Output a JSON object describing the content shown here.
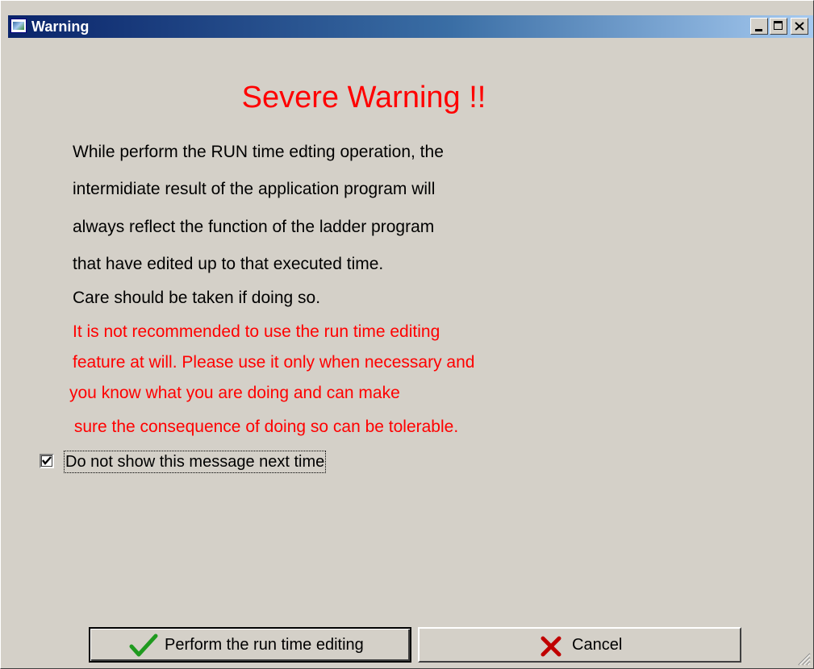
{
  "window": {
    "title": "Warning",
    "controls": {
      "minimize": "minimize",
      "maximize": "maximize",
      "close": "close"
    }
  },
  "heading": "Severe Warning !!",
  "message": {
    "lines": [
      "While perform the RUN time edting operation, the",
      "intermidiate result of the application program will",
      "always reflect the function of the ladder program",
      "that have edited up to that executed time.",
      "Care should be taken if doing so."
    ],
    "warning_lines": [
      "It is not recommended to use the run time editing",
      "feature at will. Please use it only when necessary and",
      "you know what you are doing and can make",
      " sure the consequence of doing so can be tolerable."
    ]
  },
  "checkbox": {
    "label": "Do not show this message next time",
    "checked": true
  },
  "buttons": {
    "ok_label": "Perform the run time editing",
    "cancel_label": "Cancel"
  },
  "colors": {
    "warning_red": "#ff0000",
    "window_face": "#d4d0c8",
    "titlebar_start": "#0a246a",
    "titlebar_end": "#a6caf0",
    "check_green": "#1f9a1f",
    "cancel_x": "#c00000"
  },
  "icons": {
    "app": "app-window-icon",
    "ok": "green-checkmark-icon",
    "cancel": "red-x-icon"
  }
}
